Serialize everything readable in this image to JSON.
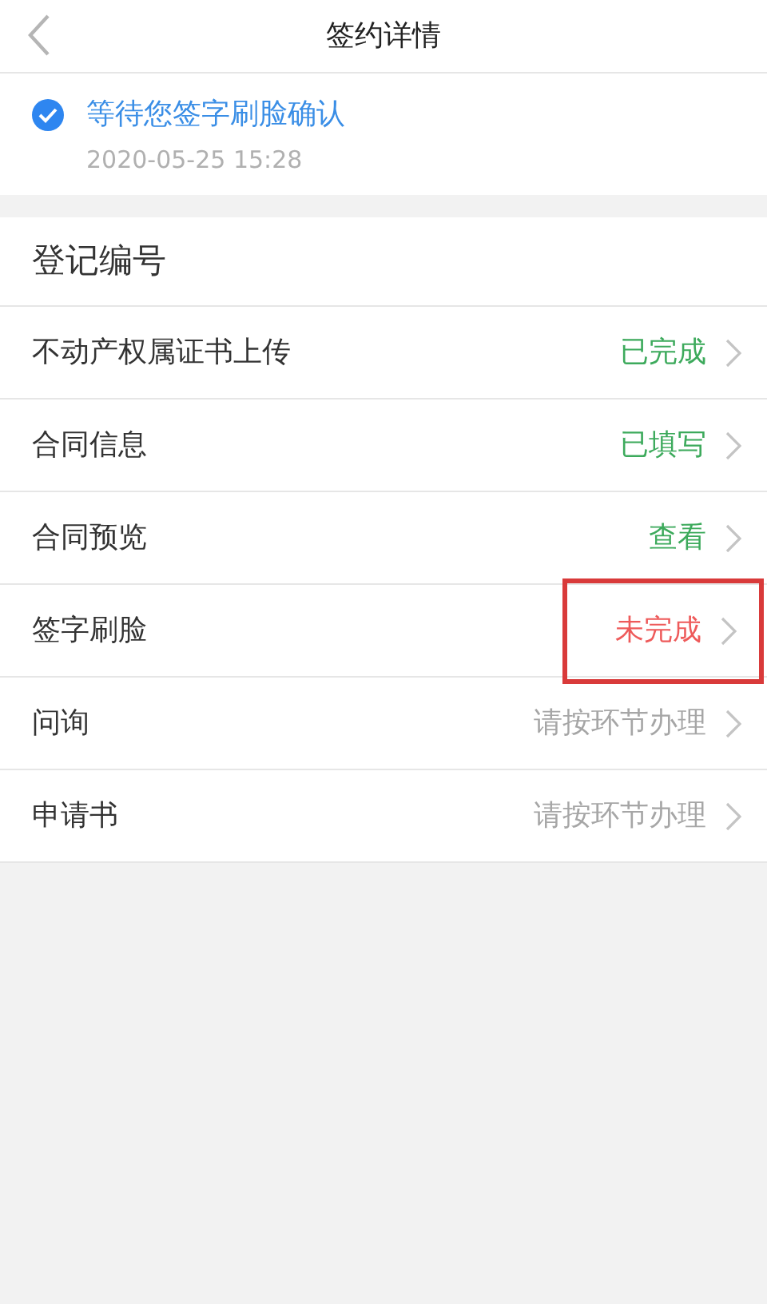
{
  "header": {
    "title": "签约详情"
  },
  "status": {
    "checked": true,
    "text": "等待您签字刷脸确认",
    "time": "2020-05-25 15:28"
  },
  "section": {
    "title": "登记编号"
  },
  "rows": [
    {
      "label": "不动产权属证书上传",
      "status": "已完成",
      "color": "#3daa5c",
      "highlighted": false
    },
    {
      "label": "合同信息",
      "status": "已填写",
      "color": "#3daa5c",
      "highlighted": false
    },
    {
      "label": "合同预览",
      "status": "查看",
      "color": "#3daa5c",
      "highlighted": false
    },
    {
      "label": "签字刷脸",
      "status": "未完成",
      "color": "#ee5a5a",
      "highlighted": true
    },
    {
      "label": "问询",
      "status": "请按环节办理",
      "color": "#a6a6a6",
      "highlighted": false
    },
    {
      "label": "申请书",
      "status": "请按环节办理",
      "color": "#a6a6a6",
      "highlighted": false
    }
  ]
}
